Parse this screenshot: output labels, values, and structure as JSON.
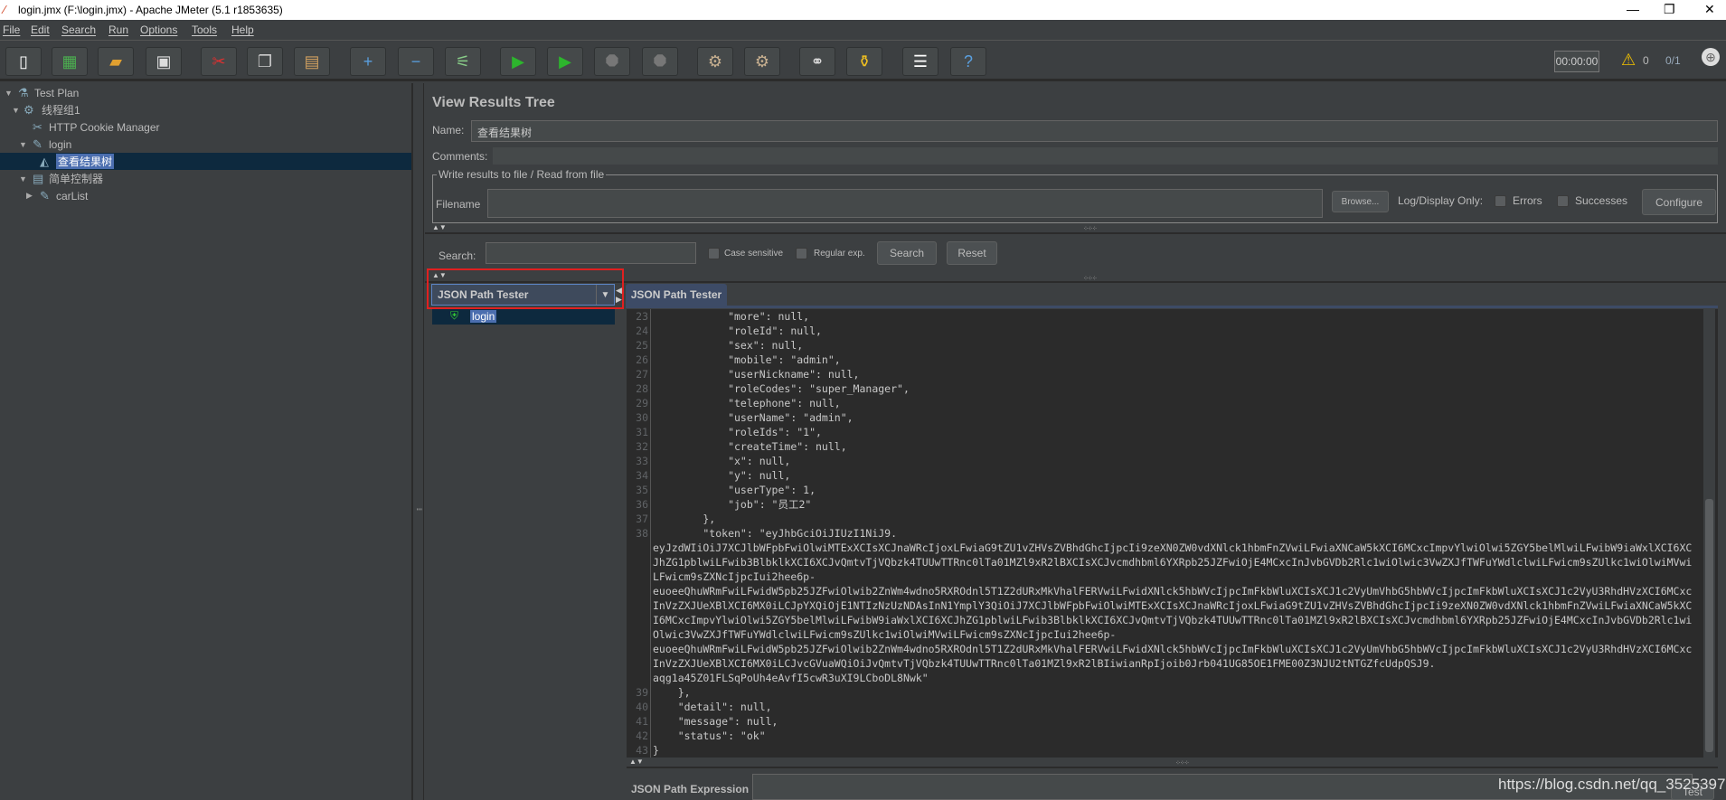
{
  "window": {
    "title": "login.jmx (F:\\login.jmx) - Apache JMeter (5.1 r1853635)",
    "minimize": "—",
    "restore": "❐",
    "close": "✕"
  },
  "menu": [
    "File",
    "Edit",
    "Search",
    "Run",
    "Options",
    "Tools",
    "Help"
  ],
  "toolbar": {
    "buttons": [
      {
        "name": "new-icon",
        "glyph": "▯",
        "color": "#ffffff"
      },
      {
        "name": "templates-icon",
        "glyph": "▦",
        "color": "#4caf50"
      },
      {
        "name": "open-icon",
        "glyph": "▰",
        "color": "#e0a030"
      },
      {
        "name": "save-icon",
        "glyph": "▣",
        "color": "#dddddd"
      },
      {
        "name": "cut-icon",
        "glyph": "✂",
        "color": "#e03030"
      },
      {
        "name": "copy-icon",
        "glyph": "❐",
        "color": "#cccccc"
      },
      {
        "name": "paste-icon",
        "glyph": "▤",
        "color": "#d0a060"
      },
      {
        "name": "expand-icon",
        "glyph": "+",
        "color": "#5aa0e0"
      },
      {
        "name": "collapse-icon",
        "glyph": "−",
        "color": "#5aa0e0"
      },
      {
        "name": "toggle-icon",
        "glyph": "⚟",
        "color": "#88cc88"
      },
      {
        "name": "start-icon",
        "glyph": "▶",
        "color": "#2db52d"
      },
      {
        "name": "start-no-pauses-icon",
        "glyph": "▶",
        "color": "#2db52d"
      },
      {
        "name": "stop-icon",
        "glyph": "⯃",
        "color": "#777777"
      },
      {
        "name": "shutdown-icon",
        "glyph": "⯃",
        "color": "#777777"
      },
      {
        "name": "clear-icon",
        "glyph": "⚙",
        "color": "#c8b090"
      },
      {
        "name": "clear-all-icon",
        "glyph": "⚙",
        "color": "#c8b090"
      },
      {
        "name": "search-binoculars-icon",
        "glyph": "⚭",
        "color": "#dddddd"
      },
      {
        "name": "reset-search-broom-icon",
        "glyph": "⚱",
        "color": "#f0c020"
      },
      {
        "name": "function-helper-icon",
        "glyph": "☰",
        "color": "#ffffff"
      },
      {
        "name": "help-icon",
        "glyph": "?",
        "color": "#5aa0e0"
      }
    ],
    "timer": "00:00:00",
    "warnings": "0",
    "threads": "0/1"
  },
  "tree": [
    {
      "label": "Test Plan",
      "icon": "flask-icon",
      "glyph": "⚗",
      "expanded": true
    },
    {
      "label": "线程组1",
      "icon": "gear-icon",
      "glyph": "⚙",
      "expanded": true
    },
    {
      "label": "HTTP Cookie Manager",
      "icon": "tools-icon",
      "glyph": "✂"
    },
    {
      "label": "login",
      "icon": "pipette-icon",
      "glyph": "✎",
      "expanded": true
    },
    {
      "label": "查看结果树",
      "icon": "chart-icon",
      "glyph": "◭",
      "selected": true
    },
    {
      "label": "简单控制器",
      "icon": "controller-icon",
      "glyph": "▤",
      "expanded": true
    },
    {
      "label": "carList",
      "icon": "pipette-icon",
      "glyph": "✎",
      "expanded": false
    }
  ],
  "panel": {
    "title": "View Results Tree",
    "name_label": "Name:",
    "name_value": "查看结果树",
    "comments_label": "Comments:",
    "write_group": "Write results to file / Read from file",
    "filename_label": "Filename",
    "browse": "Browse...",
    "log_display": "Log/Display Only:",
    "errors": "Errors",
    "successes": "Successes",
    "configure": "Configure",
    "search_label": "Search:",
    "case_sensitive": "Case sensitive",
    "regular_exp": "Regular exp.",
    "search_btn": "Search",
    "reset_btn": "Reset",
    "renderer": "JSON Path Tester",
    "tab": "JSON Path Tester",
    "sample": "login",
    "json_path_label": "JSON Path Expression",
    "test_btn": "Test",
    "highlight_color": "#e02020"
  },
  "code": [
    {
      "n": "23",
      "t": "            \"more\": null,"
    },
    {
      "n": "24",
      "t": "            \"roleId\": null,"
    },
    {
      "n": "25",
      "t": "            \"sex\": null,"
    },
    {
      "n": "26",
      "t": "            \"mobile\": \"admin\","
    },
    {
      "n": "27",
      "t": "            \"userNickname\": null,"
    },
    {
      "n": "28",
      "t": "            \"roleCodes\": \"super_Manager\","
    },
    {
      "n": "29",
      "t": "            \"telephone\": null,"
    },
    {
      "n": "30",
      "t": "            \"userName\": \"admin\","
    },
    {
      "n": "31",
      "t": "            \"roleIds\": \"1\","
    },
    {
      "n": "32",
      "t": "            \"createTime\": null,"
    },
    {
      "n": "33",
      "t": "            \"x\": null,"
    },
    {
      "n": "34",
      "t": "            \"y\": null,"
    },
    {
      "n": "35",
      "t": "            \"userType\": 1,"
    },
    {
      "n": "36",
      "t": "            \"job\": \"员工2\""
    },
    {
      "n": "37",
      "t": "        },"
    },
    {
      "n": "38",
      "t": "        \"token\": \"eyJhbGciOiJIUzI1NiJ9."
    },
    {
      "n": "",
      "t": "eyJzdWIiOiJ7XCJlbWFpbFwiOlwiMTExXCIsXCJnaWRcIjoxLFwiaG9tZU1vZHVsZVBhdGhcIjpcIi9zeXN0ZW0vdXNlck1hbmFnZVwiLFwiaXNCaW5kXCI6MCxcImpvYlwiOlwi5ZGY5belMlwiLFwibW9iaWxlXCI6XC"
    },
    {
      "n": "",
      "t": "JhZG1pblwiLFwib3BlbklkXCI6XCJvQmtvTjVQbzk4TUUwTTRnc0lTa01MZl9xR2lBXCIsXCJvcmdhbml6YXRpb25JZFwiOjE4MCxcInJvbGVDb2Rlc1wiOlwic3VwZXJfTWFuYWdlclwiLFwicm9sZUlkc1wiOlwiMVwi"
    },
    {
      "n": "",
      "t": "LFwicm9sZXNcIjpcIui2hee6p-"
    },
    {
      "n": "",
      "t": "euoeeQhuWRmFwiLFwidW5pb25JZFwiOlwib2ZnWm4wdno5RXROdnl5T1Z2dURxMkVhalFERVwiLFwidXNlck5hbWVcIjpcImFkbWluXCIsXCJ1c2VyUmVhbG5hbWVcIjpcImFkbWluXCIsXCJ1c2VyU3RhdHVzXCI6MCxc"
    },
    {
      "n": "",
      "t": "InVzZXJUeXBlXCI6MX0iLCJpYXQiOjE1NTIzNzUzNDAsInN1YmplY3QiOiJ7XCJlbWFpbFwiOlwiMTExXCIsXCJnaWRcIjoxLFwiaG9tZU1vZHVsZVBhdGhcIjpcIi9zeXN0ZW0vdXNlck1hbmFnZVwiLFwiaXNCaW5kXC"
    },
    {
      "n": "",
      "t": "I6MCxcImpvYlwiOlwi5ZGY5belMlwiLFwibW9iaWxlXCI6XCJhZG1pblwiLFwib3BlbklkXCI6XCJvQmtvTjVQbzk4TUUwTTRnc0lTa01MZl9xR2lBXCIsXCJvcmdhbml6YXRpb25JZFwiOjE4MCxcInJvbGVDb2Rlc1wi"
    },
    {
      "n": "",
      "t": "Olwic3VwZXJfTWFuYWdlclwiLFwicm9sZUlkc1wiOlwiMVwiLFwicm9sZXNcIjpcIui2hee6p-"
    },
    {
      "n": "",
      "t": "euoeeQhuWRmFwiLFwidW5pb25JZFwiOlwib2ZnWm4wdno5RXROdnl5T1Z2dURxMkVhalFERVwiLFwidXNlck5hbWVcIjpcImFkbWluXCIsXCJ1c2VyUmVhbG5hbWVcIjpcImFkbWluXCIsXCJ1c2VyU3RhdHVzXCI6MCxc"
    },
    {
      "n": "",
      "t": "InVzZXJUeXBlXCI6MX0iLCJvcGVuaWQiOiJvQmtvTjVQbzk4TUUwTTRnc0lTa01MZl9xR2lBIiwianRpIjoib0Jrb041UG85OE1FME00Z3NJU2tNTGZfcUdpQSJ9."
    },
    {
      "n": "",
      "t": "aqg1a45Z01FLSqPoUh4eAvfI5cwR3uXI9LCboDL8Nwk\""
    },
    {
      "n": "39",
      "t": "    },"
    },
    {
      "n": "40",
      "t": "    \"detail\": null,"
    },
    {
      "n": "41",
      "t": "    \"message\": null,"
    },
    {
      "n": "42",
      "t": "    \"status\": \"ok\""
    },
    {
      "n": "43",
      "t": "}"
    }
  ],
  "watermark": "https://blog.csdn.net/qq_35253970"
}
